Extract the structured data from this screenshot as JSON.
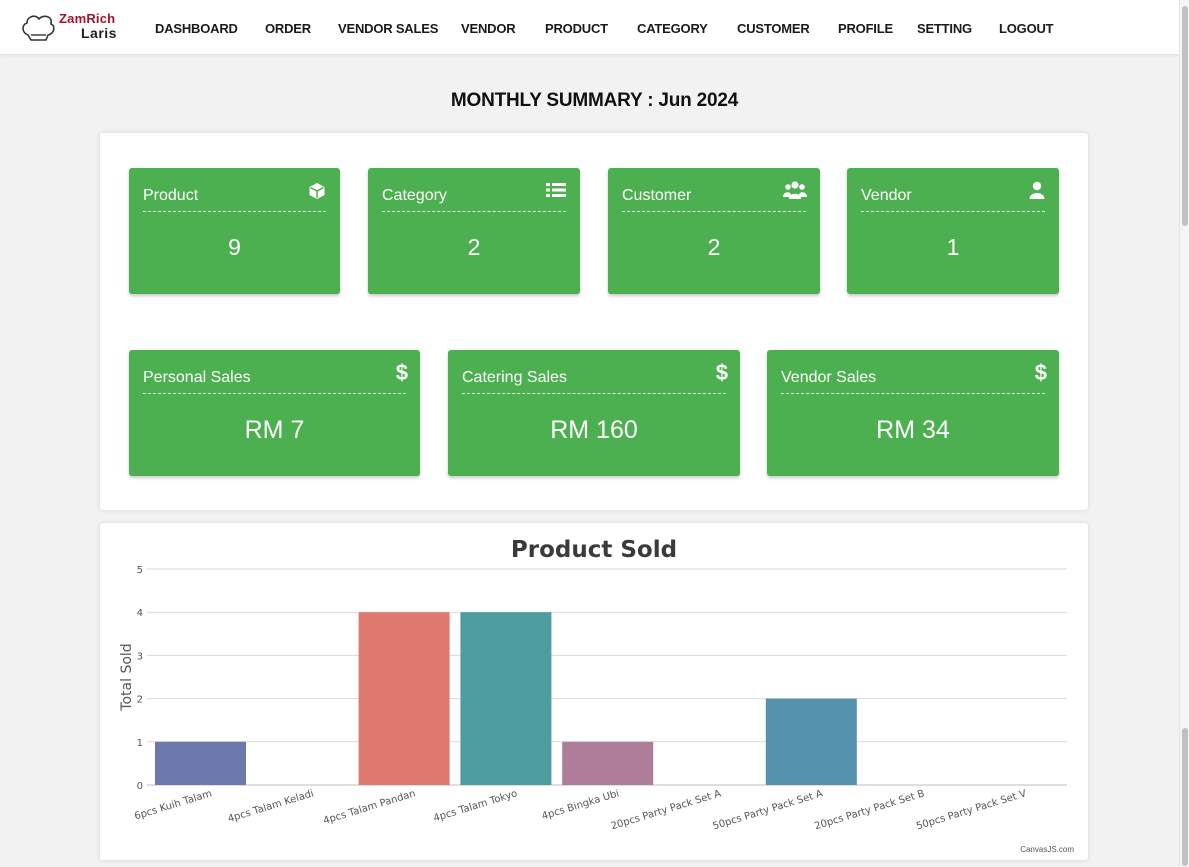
{
  "brand": {
    "line1": "ZamRich",
    "line2": "Laris"
  },
  "nav": [
    "DASHBOARD",
    "ORDER",
    "VENDOR SALES",
    "VENDOR",
    "PRODUCT",
    "CATEGORY",
    "CUSTOMER",
    "PROFILE",
    "SETTING",
    "LOGOUT"
  ],
  "summary": {
    "title": "MONTHLY SUMMARY : Jun 2024",
    "counts": [
      {
        "label": "Product",
        "value": "9",
        "icon": "cube-icon"
      },
      {
        "label": "Category",
        "value": "2",
        "icon": "list-icon"
      },
      {
        "label": "Customer",
        "value": "2",
        "icon": "users-icon"
      },
      {
        "label": "Vendor",
        "value": "1",
        "icon": "user-icon"
      }
    ],
    "sales": [
      {
        "label": "Personal Sales",
        "value": "RM 7",
        "icon": "dollar-icon"
      },
      {
        "label": "Catering Sales",
        "value": "RM 160",
        "icon": "dollar-icon"
      },
      {
        "label": "Vendor Sales",
        "value": "RM 34",
        "icon": "dollar-icon"
      }
    ],
    "card_color": "#4caf50"
  },
  "chart_data": {
    "type": "bar",
    "title": "Product Sold",
    "xlabel": "",
    "ylabel": "Total Sold",
    "ylim": [
      0,
      5
    ],
    "yticks": [
      0,
      1,
      2,
      3,
      4,
      5
    ],
    "grid": true,
    "credit": "CanvasJS.com",
    "categories": [
      "6pcs Kuih Talam",
      "4pcs Talam Keladi",
      "4pcs Talam Pandan",
      "4pcs Talam Tokyo",
      "4pcs Bingka Ubi",
      "20pcs Party Pack Set A",
      "50pcs Party Pack Set A",
      "20pcs Party Pack Set B",
      "50pcs Party Pack Set V"
    ],
    "values": [
      1,
      0,
      4,
      4,
      1,
      0,
      2,
      0,
      0
    ],
    "colors": [
      "#6d78ad",
      "#51cda0",
      "#df7970",
      "#4c9ca0",
      "#ae7d99",
      "#c9d45c",
      "#5592ad",
      "#df874d",
      "#52bca8"
    ]
  }
}
